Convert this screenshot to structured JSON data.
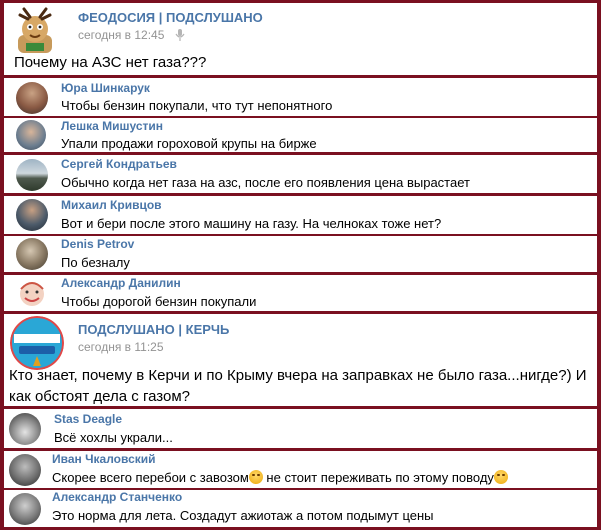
{
  "posts": [
    {
      "author": "ФЕОДОСИЯ | ПОДСЛУШАНО",
      "time": "сегодня в 12:45",
      "text": "Почему на АЗС нет газа???",
      "comments": [
        {
          "name": "Юра Шинкарук",
          "text": "Чтобы бензин покупали, что тут непонятного"
        },
        {
          "name": "Лешка Мишустин",
          "text": "Упали продажи гороховой крупы на бирже"
        },
        {
          "name": "Сергей Кондратьев",
          "text": "Обычно когда нет газа на азс, после его появления цена вырастает"
        },
        {
          "name": "Михаил Кривцов",
          "text": "Вот и бери после этого машину на газу. На челноках тоже нет?"
        },
        {
          "name": "Denis Petrov",
          "text": "По безналу"
        },
        {
          "name": "Александр Данилин",
          "text": "Чтобы дорогой бензин покупали"
        }
      ]
    },
    {
      "author": "ПОДСЛУШАНО | КЕРЧЬ",
      "time": "сегодня в 11:25",
      "avatar_text": "ПОДСЛУШАНО КЕРЧЬ",
      "text_line1": "Кто знает, почему в Керчи и по Крыму вчера на заправках не было газа...нигде?) И",
      "text_line2": "как обстоят дела с газом?",
      "comments": [
        {
          "name": "Stas Deagle",
          "text": "Всё хохлы украли..."
        },
        {
          "name": "Иван Чкаловский",
          "text_a": "Скорее всего перебои с завозом",
          "text_b": " не стоит переживать по этому поводу"
        },
        {
          "name": "Александр Станченко",
          "text": "Это норма для лета. Создадут ажиотаж а потом подымут цены"
        }
      ]
    }
  ],
  "icons": {
    "mobile": "microphone-icon",
    "emoji": "grinning-face-emoji-icon"
  },
  "colors": {
    "border": "#7a1020",
    "link": "#4a76a8",
    "meta": "#939393"
  }
}
